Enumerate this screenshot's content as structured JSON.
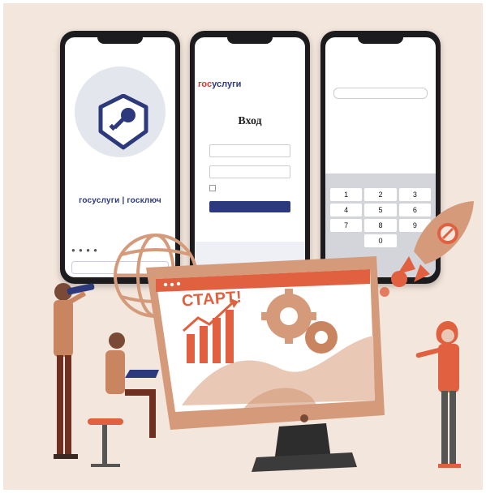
{
  "illustration": {
    "background_color": "#f3e6dc",
    "phone_onboarding": {
      "app_label": "госуслуги | госключ",
      "pager_dots": "● ● ● ●",
      "icon": "shield-key-icon"
    },
    "phone_login": {
      "brand_gos": "гос",
      "brand_uslugi": "услуги",
      "title": "Вход"
    },
    "phone_pin": {
      "keys": [
        "1",
        "2",
        "3",
        "4",
        "5",
        "6",
        "7",
        "8",
        "9",
        "",
        "0",
        ""
      ]
    },
    "monitor": {
      "banner_text": "СТАРТ!",
      "icons": [
        "gears-icon",
        "growth-chart-icon",
        "rocket-icon",
        "globe-icon"
      ]
    },
    "colors": {
      "accent_orange": "#e1603f",
      "brand_blue": "#2c3a7d",
      "brand_red": "#e3342f",
      "monitor_frame": "#d49a7a"
    }
  }
}
